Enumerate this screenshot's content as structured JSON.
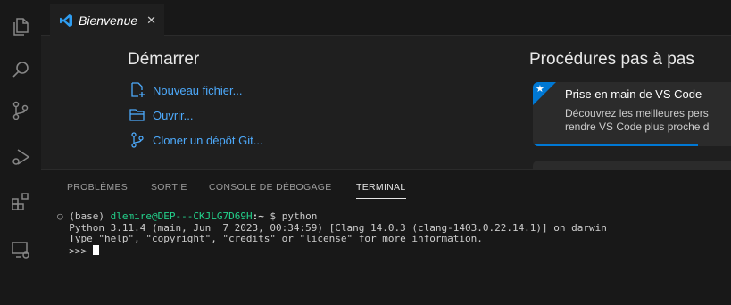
{
  "tab": {
    "label": "Bienvenue",
    "close": "✕"
  },
  "welcome": {
    "start_title": "Démarrer",
    "start_items": [
      {
        "label": "Nouveau fichier...",
        "icon": "new-file-icon"
      },
      {
        "label": "Ouvrir...",
        "icon": "folder-open-icon"
      },
      {
        "label": "Cloner un dépôt Git...",
        "icon": "source-control-icon"
      }
    ],
    "walkthrough_title": "Procédures pas à pas",
    "card": {
      "title": "Prise en main de VS Code",
      "desc_line1": "Découvrez les meilleures pers",
      "desc_line2": "rendre VS Code plus proche d",
      "progress": 0.77
    }
  },
  "panel": {
    "tabs": [
      "PROBLÈMES",
      "SORTIE",
      "CONSOLE DE DÉBOGAGE",
      "TERMINAL"
    ],
    "active_tab": "TERMINAL"
  },
  "terminal": {
    "env": "(base)",
    "user_host": "dlemire@DEP---CKJLG7D69H",
    "path": ":~",
    "prompt_cmd": " $ python",
    "line2": "Python 3.11.4 (main, Jun  7 2023, 00:34:59) [Clang 14.0.3 (clang-1403.0.22.14.1)] on darwin",
    "line3": "Type \"help\", \"copyright\", \"credits\" or \"license\" for more information.",
    "repl_prompt": ">>> "
  },
  "colors": {
    "accent": "#0078d4",
    "link": "#4daafc",
    "terminal_user": "#23d18b"
  }
}
